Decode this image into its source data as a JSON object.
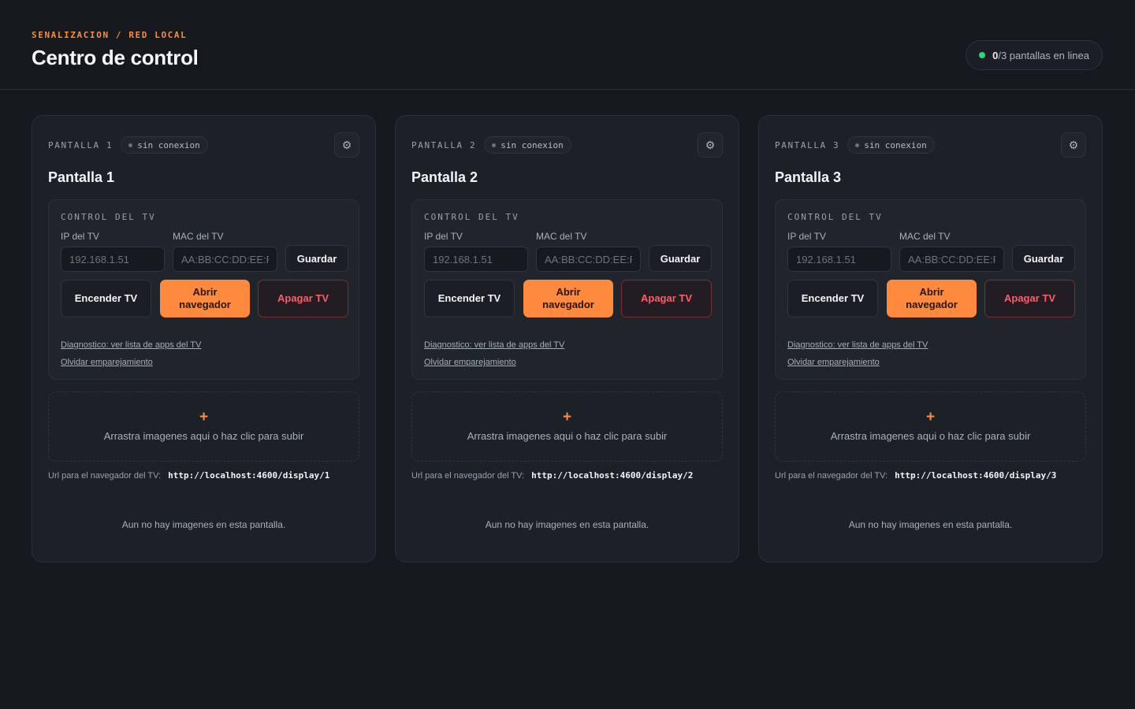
{
  "header": {
    "eyebrow": "SENALIZACION / RED LOCAL",
    "title": "Centro de control",
    "online_count": "0",
    "online_total": "/3 pantallas en linea",
    "online_color": "#2fd37a"
  },
  "accent_color": "#ff8a3d",
  "danger_color": "#ff5c6a",
  "cards": [
    {
      "code": "PANTALLA 1",
      "status": "sin conexion",
      "settings_icon": "gear-icon",
      "title": "Pantalla 1",
      "panel_label": "CONTROL DEL TV",
      "ip_label": "IP del TV",
      "ip_placeholder": "192.168.1.51",
      "mac_label": "MAC del TV",
      "mac_placeholder": "AA:BB:CC:DD:EE:FF",
      "save_label": "Guardar",
      "power_on_label": "Encender TV",
      "open_browser_label": "Abrir navegador",
      "power_off_label": "Apagar TV",
      "diag_link": "Diagnostico: ver lista de apps del TV",
      "forget_link": "Olvidar emparejamiento",
      "dropzone_icon": "plus-icon",
      "dropzone_text": "Arrastra imagenes aqui o haz clic para subir",
      "url_label": "Url para el navegador del TV:",
      "url_value": "http://localhost:4600/display/1",
      "empty_text": "Aun no hay imagenes en esta pantalla."
    },
    {
      "code": "PANTALLA 2",
      "status": "sin conexion",
      "settings_icon": "gear-icon",
      "title": "Pantalla 2",
      "panel_label": "CONTROL DEL TV",
      "ip_label": "IP del TV",
      "ip_placeholder": "192.168.1.51",
      "mac_label": "MAC del TV",
      "mac_placeholder": "AA:BB:CC:DD:EE:FF",
      "save_label": "Guardar",
      "power_on_label": "Encender TV",
      "open_browser_label": "Abrir navegador",
      "power_off_label": "Apagar TV",
      "diag_link": "Diagnostico: ver lista de apps del TV",
      "forget_link": "Olvidar emparejamiento",
      "dropzone_icon": "plus-icon",
      "dropzone_text": "Arrastra imagenes aqui o haz clic para subir",
      "url_label": "Url para el navegador del TV:",
      "url_value": "http://localhost:4600/display/2",
      "empty_text": "Aun no hay imagenes en esta pantalla."
    },
    {
      "code": "PANTALLA 3",
      "status": "sin conexion",
      "settings_icon": "gear-icon",
      "title": "Pantalla 3",
      "panel_label": "CONTROL DEL TV",
      "ip_label": "IP del TV",
      "ip_placeholder": "192.168.1.51",
      "mac_label": "MAC del TV",
      "mac_placeholder": "AA:BB:CC:DD:EE:FF",
      "save_label": "Guardar",
      "power_on_label": "Encender TV",
      "open_browser_label": "Abrir navegador",
      "power_off_label": "Apagar TV",
      "diag_link": "Diagnostico: ver lista de apps del TV",
      "forget_link": "Olvidar emparejamiento",
      "dropzone_icon": "plus-icon",
      "dropzone_text": "Arrastra imagenes aqui o haz clic para subir",
      "url_label": "Url para el navegador del TV:",
      "url_value": "http://localhost:4600/display/3",
      "empty_text": "Aun no hay imagenes en esta pantalla."
    }
  ]
}
